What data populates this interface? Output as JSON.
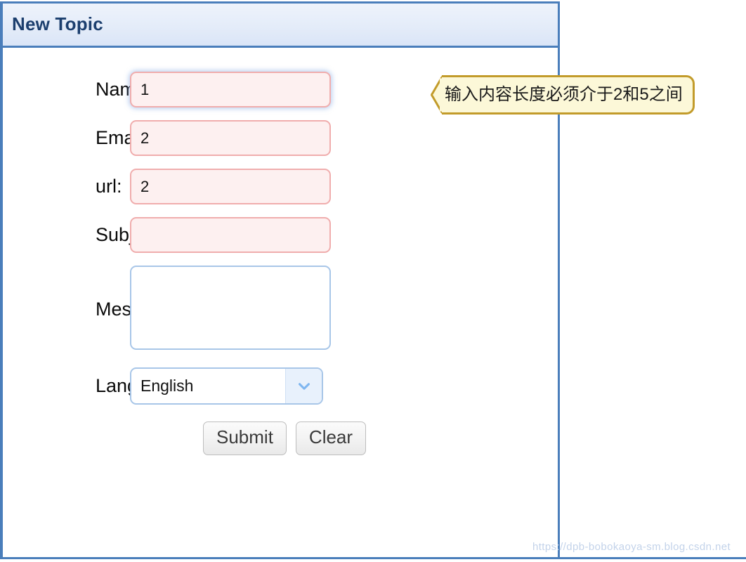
{
  "panel": {
    "title": "New Topic"
  },
  "form": {
    "fields": [
      {
        "label": "Name:",
        "value": "1",
        "state": "invalid",
        "focused": true,
        "type": "text"
      },
      {
        "label": "Email:",
        "value": "2",
        "state": "invalid",
        "focused": false,
        "type": "text"
      },
      {
        "label": "url:",
        "value": "2",
        "state": "invalid",
        "focused": false,
        "type": "text"
      },
      {
        "label": "Subject:",
        "value": "",
        "state": "invalid",
        "focused": false,
        "type": "text"
      },
      {
        "label": "Message:",
        "value": "",
        "state": "valid",
        "focused": false,
        "type": "textarea"
      },
      {
        "label": "Language:",
        "value": "English",
        "state": "valid",
        "focused": false,
        "type": "select"
      }
    ],
    "language_options": [
      "English"
    ]
  },
  "buttons": {
    "submit_label": "Submit",
    "clear_label": "Clear"
  },
  "tooltip": {
    "message": "输入内容长度必须介于2和5之间"
  },
  "watermark": {
    "text": "https://dpb-bobokaoya-sm.blog.csdn.net"
  },
  "colors": {
    "panel_border": "#4a7ebb",
    "header_text": "#1c3f6e",
    "invalid_border": "#f0adad",
    "invalid_background": "#fdf0f0",
    "valid_border": "#a8c6e8",
    "tooltip_background": "#fcf8d8",
    "tooltip_border": "#c29b2a",
    "select_arrow": "#7eb6f0"
  }
}
